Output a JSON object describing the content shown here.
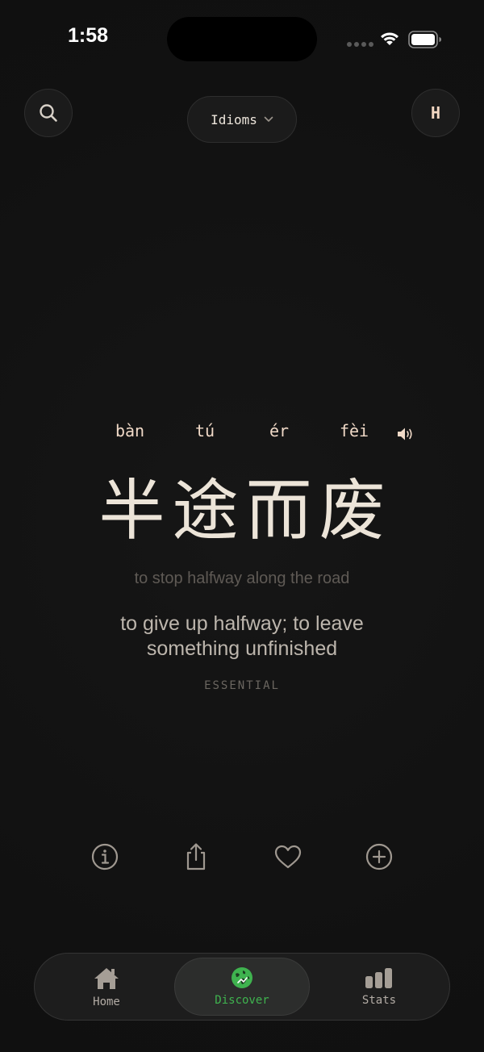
{
  "status_bar": {
    "time": "1:58"
  },
  "header": {
    "category": "Idioms",
    "avatar_initial": "H"
  },
  "idiom": {
    "pinyin": [
      "bàn",
      "tú",
      "ér",
      "fèi"
    ],
    "characters": [
      "半",
      "途",
      "而",
      "废"
    ],
    "literal": "to stop halfway along the road",
    "meaning": "to give up halfway; to leave something unfinished",
    "level": "ESSENTIAL"
  },
  "actions": [
    {
      "icon": "info-icon"
    },
    {
      "icon": "share-icon"
    },
    {
      "icon": "heart-icon"
    },
    {
      "icon": "plus-circle-icon"
    }
  ],
  "tab_bar": {
    "tabs": [
      {
        "label": "Home",
        "icon": "house-icon"
      },
      {
        "label": "Discover",
        "icon": "globe-icon",
        "active": true
      },
      {
        "label": "Stats",
        "icon": "bar-chart-icon"
      }
    ]
  },
  "colors": {
    "accent": "#3fb34f",
    "pinyin": "#f0d9c7",
    "background": "#111111"
  }
}
